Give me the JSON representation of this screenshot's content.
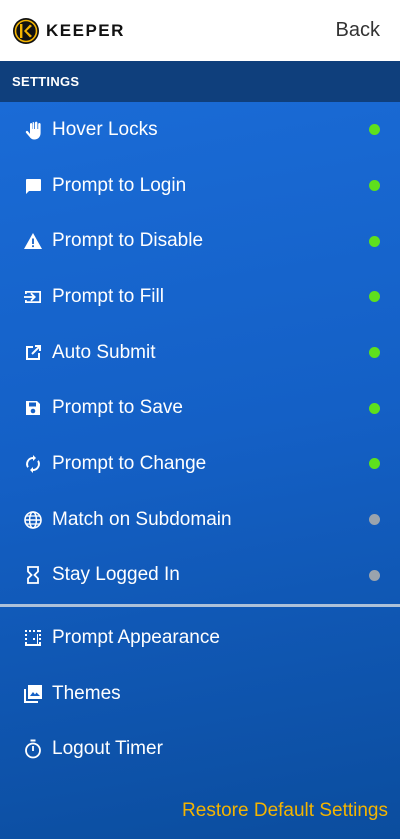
{
  "header": {
    "brand": "KEEPER",
    "back_label": "Back"
  },
  "section_title": "SETTINGS",
  "toggles": [
    {
      "label": "Hover Locks",
      "icon": "hand-icon",
      "enabled": true
    },
    {
      "label": "Prompt to Login",
      "icon": "chat-bubble-icon",
      "enabled": true
    },
    {
      "label": "Prompt to Disable",
      "icon": "warning-icon",
      "enabled": true
    },
    {
      "label": "Prompt to Fill",
      "icon": "fill-input-icon",
      "enabled": true
    },
    {
      "label": "Auto Submit",
      "icon": "external-open-icon",
      "enabled": true
    },
    {
      "label": "Prompt to Save",
      "icon": "save-icon",
      "enabled": true
    },
    {
      "label": "Prompt to Change",
      "icon": "refresh-icon",
      "enabled": true
    },
    {
      "label": "Match on Subdomain",
      "icon": "globe-icon",
      "enabled": false
    },
    {
      "label": "Stay Logged In",
      "icon": "hourglass-icon",
      "enabled": false
    }
  ],
  "links": [
    {
      "label": "Prompt Appearance",
      "icon": "grid-outline-icon"
    },
    {
      "label": "Themes",
      "icon": "image-gallery-icon"
    },
    {
      "label": "Logout Timer",
      "icon": "timer-icon"
    }
  ],
  "restore_label": "Restore Default Settings",
  "colors": {
    "enabled_dot": "#5ee01c",
    "disabled_dot": "#9aa3ad",
    "accent_restore": "#f4b400"
  }
}
